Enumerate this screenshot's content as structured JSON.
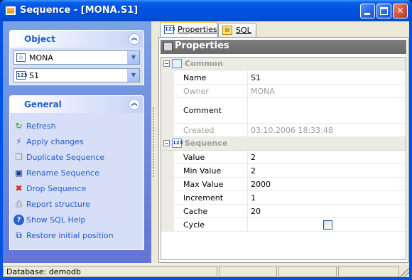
{
  "window": {
    "title": "Sequence - [MONA.S1]"
  },
  "object_group": {
    "title": "Object",
    "database": "MONA",
    "sequence": "S1"
  },
  "general_group": {
    "title": "General",
    "actions": [
      {
        "label": "Refresh",
        "icon": "refresh-icon"
      },
      {
        "label": "Apply changes",
        "icon": "apply-icon"
      },
      {
        "label": "Duplicate Sequence",
        "icon": "duplicate-icon"
      },
      {
        "label": "Rename Sequence",
        "icon": "rename-icon"
      },
      {
        "label": "Drop Sequence",
        "icon": "drop-icon"
      },
      {
        "label": "Report structure",
        "icon": "report-icon"
      },
      {
        "label": "Show SQL Help",
        "icon": "help-icon"
      },
      {
        "label": "Restore initial position",
        "icon": "restore-icon"
      }
    ]
  },
  "tabs": [
    {
      "label": "Properties",
      "active": true
    },
    {
      "label": "SQL",
      "active": false
    }
  ],
  "properties": {
    "header": "Properties",
    "categories": {
      "common": "Common",
      "sequence": "Sequence"
    },
    "common_rows": [
      {
        "name": "Name",
        "value": "S1",
        "disabled": false
      },
      {
        "name": "Owner",
        "value": "MONA",
        "disabled": true
      },
      {
        "name": "Comment",
        "value": "",
        "disabled": false
      },
      {
        "name": "Created",
        "value": "03.10.2006 18:33:48",
        "disabled": true
      }
    ],
    "sequence_rows": [
      {
        "name": "Value",
        "value": "2"
      },
      {
        "name": "Min Value",
        "value": "2"
      },
      {
        "name": "Max Value",
        "value": "2000"
      },
      {
        "name": "Increment",
        "value": "1"
      },
      {
        "name": "Cache",
        "value": "20"
      },
      {
        "name": "Cycle",
        "value": "",
        "checked": false
      }
    ]
  },
  "statusbar": {
    "database": "Database: demodb"
  },
  "colors": {
    "titlebar": "#0054e3",
    "panel_link": "#215dc6",
    "tab_highlight": "#ffc83c"
  }
}
